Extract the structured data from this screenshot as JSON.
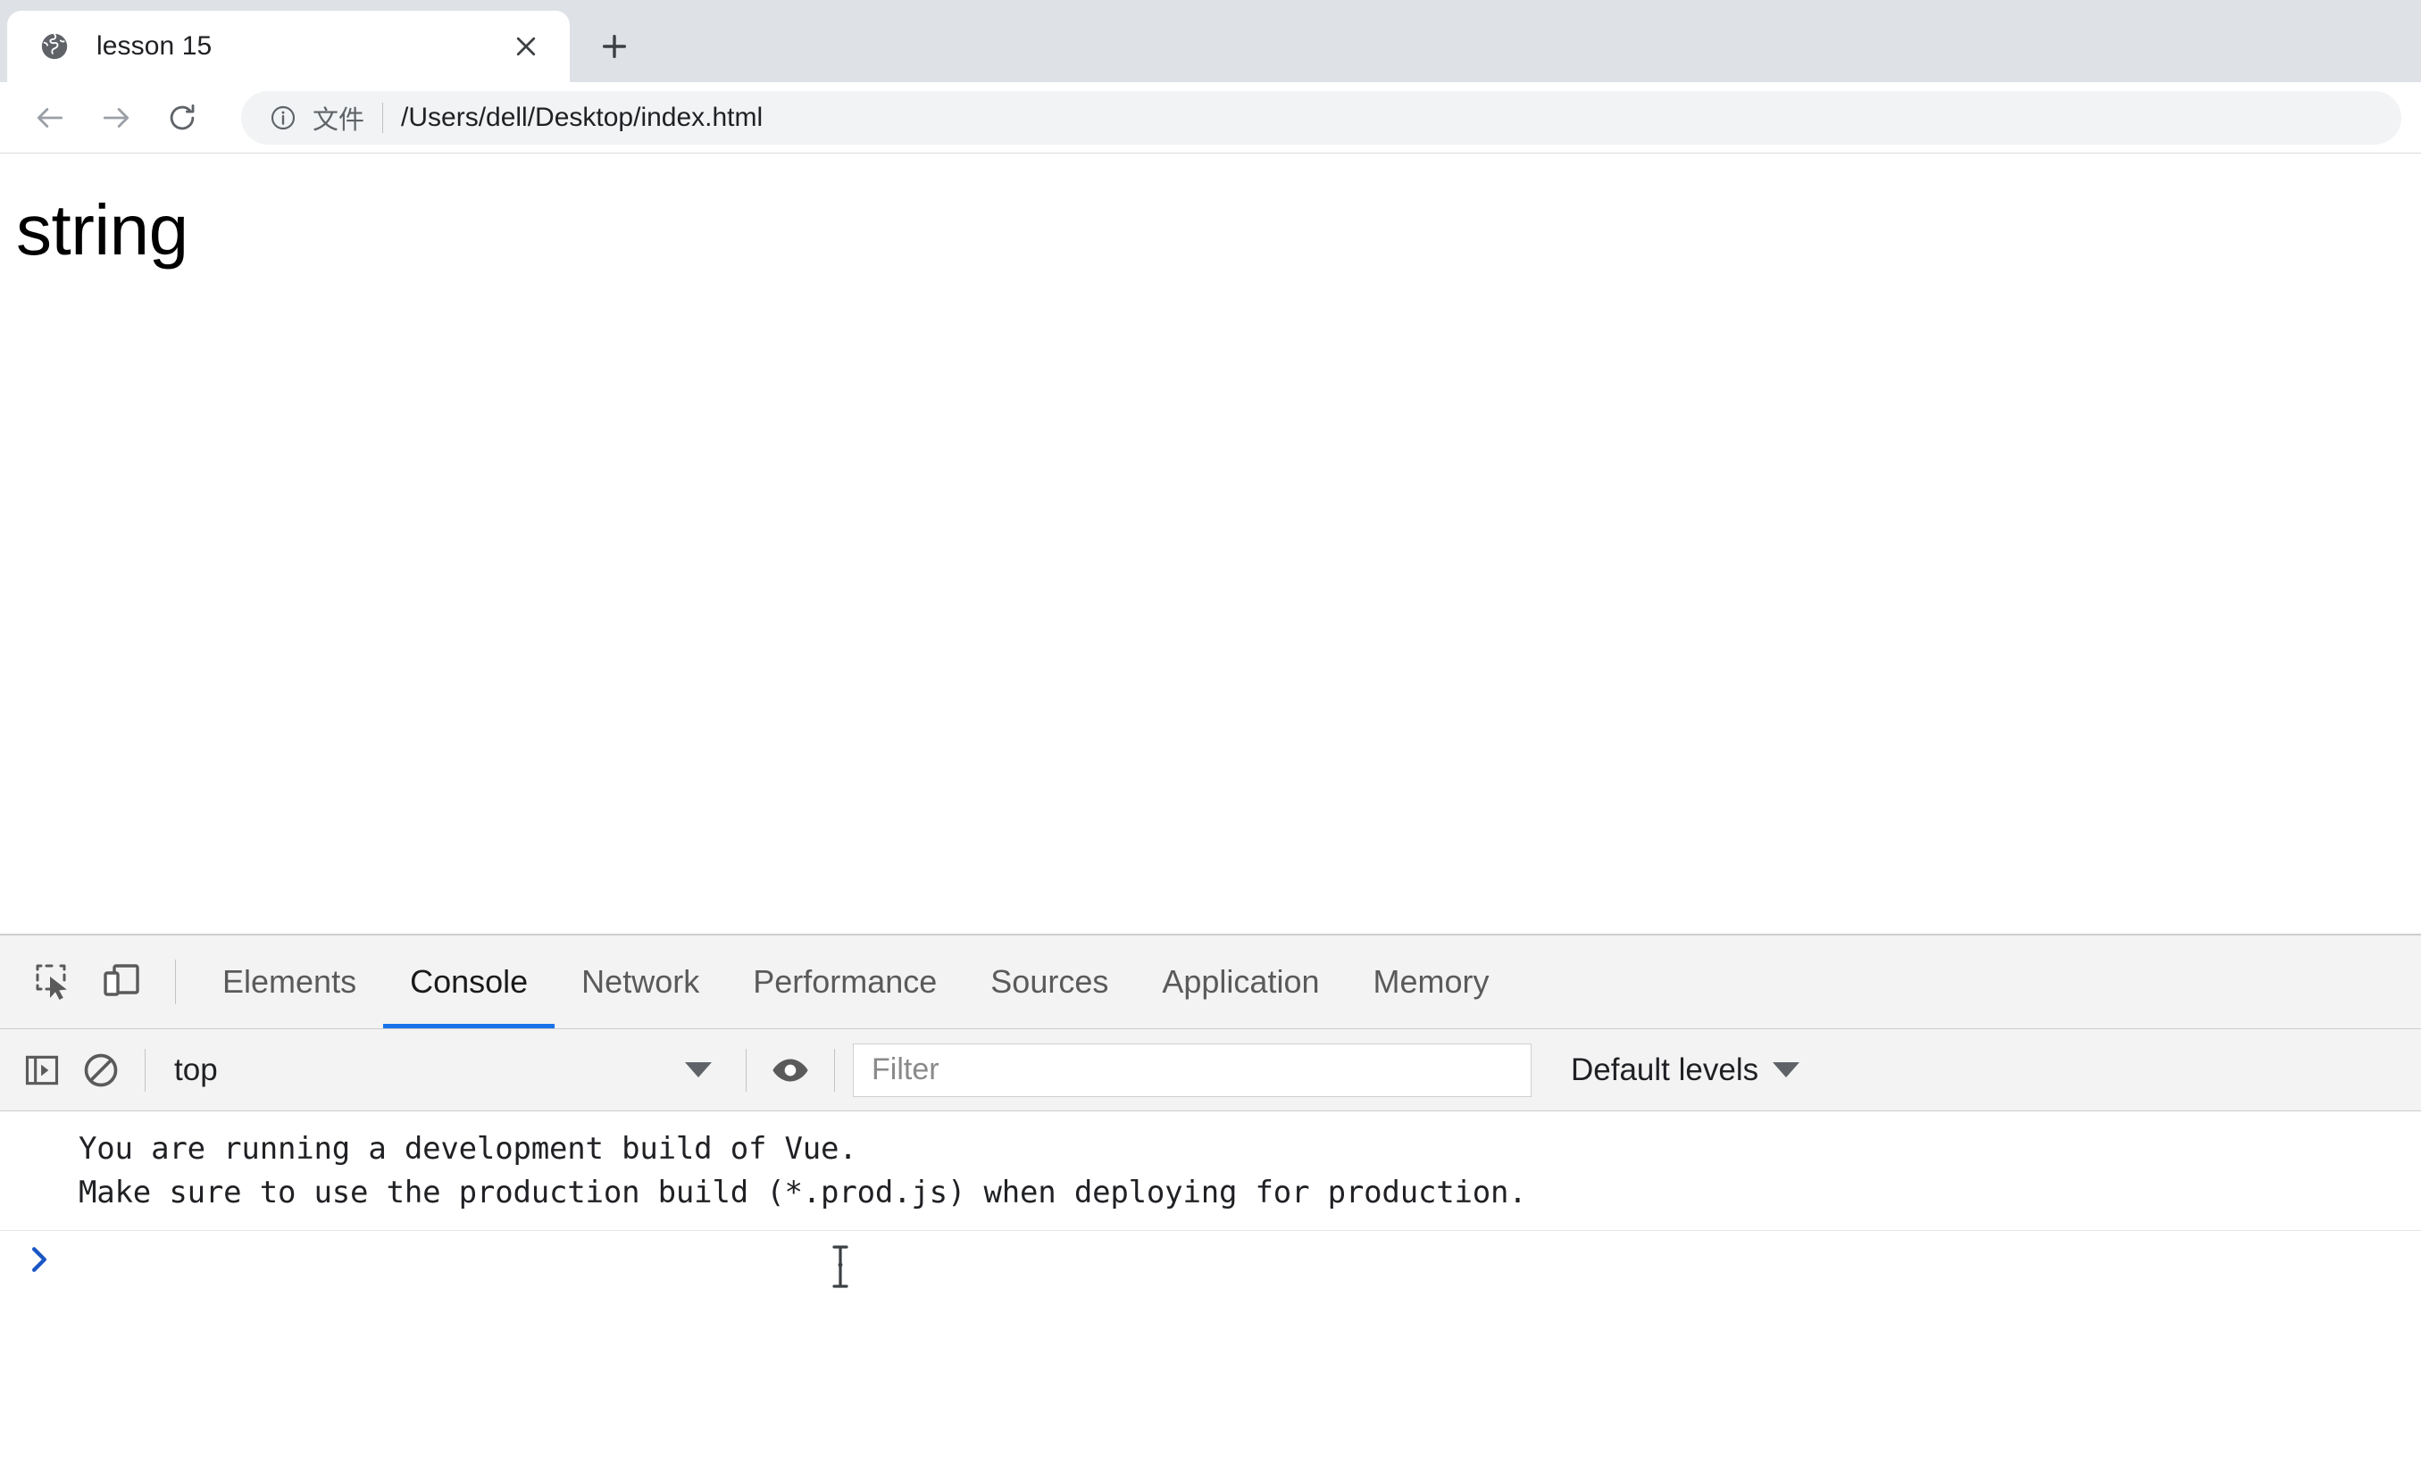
{
  "browser": {
    "tab": {
      "title": "lesson 15",
      "favicon_icon": "globe-icon",
      "close_icon": "close-icon"
    },
    "new_tab_icon": "plus-icon",
    "nav": {
      "back_icon": "arrow-left-icon",
      "forward_icon": "arrow-right-icon",
      "reload_icon": "reload-icon"
    },
    "omnibox": {
      "info_icon": "info-circle-icon",
      "scheme_label": "文件",
      "url": "/Users/dell/Desktop/index.html"
    }
  },
  "page": {
    "heading": "string"
  },
  "devtools": {
    "inspect_icon": "inspect-element-icon",
    "device_toolbar_icon": "device-toolbar-icon",
    "tabs": [
      {
        "label": "Elements",
        "active": false
      },
      {
        "label": "Console",
        "active": true
      },
      {
        "label": "Network",
        "active": false
      },
      {
        "label": "Performance",
        "active": false
      },
      {
        "label": "Sources",
        "active": false
      },
      {
        "label": "Application",
        "active": false
      },
      {
        "label": "Memory",
        "active": false
      }
    ],
    "active_tab": "Console",
    "console_toolbar": {
      "sidebar_toggle_icon": "console-sidebar-toggle-icon",
      "clear_icon": "clear-console-icon",
      "context_value": "top",
      "context_caret_icon": "chevron-down-icon",
      "live_expression_icon": "eye-icon",
      "filter_placeholder": "Filter",
      "filter_value": "",
      "levels_label": "Default levels",
      "levels_caret_icon": "chevron-down-icon"
    },
    "console_messages": [
      "You are running a development build of Vue.\nMake sure to use the production build (*.prod.js) when deploying for production."
    ],
    "prompt": {
      "chevron_icon": "prompt-chevron-icon",
      "value": "",
      "cursor_icon": "text-ibeam-cursor"
    }
  },
  "colors": {
    "tabstrip_bg": "#dee1e6",
    "accent_blue": "#1a73e8",
    "devtools_bg": "#f3f3f3",
    "text_primary": "#202124"
  }
}
